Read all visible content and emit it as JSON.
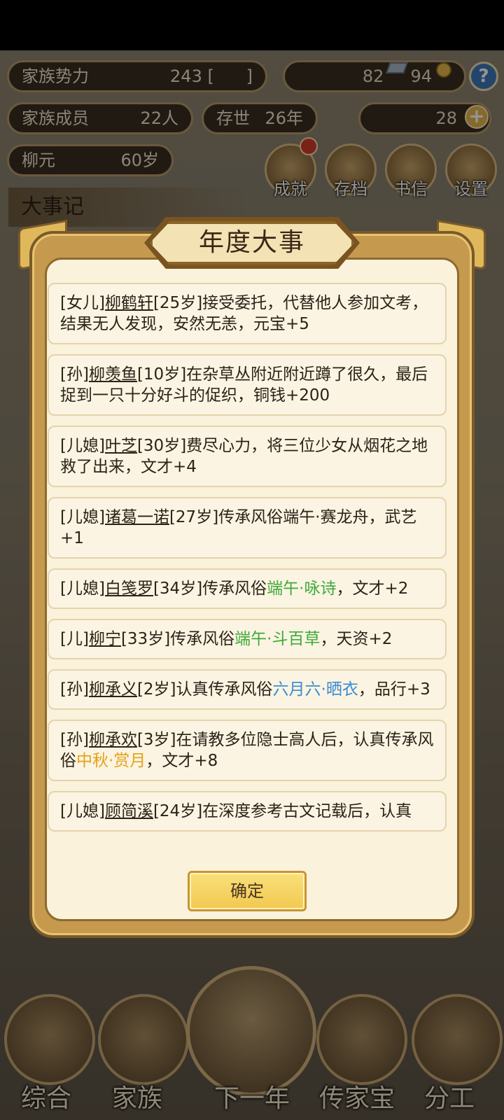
{
  "top_stats": {
    "influence_label": "家族势力",
    "influence_value": "243",
    "members_label": "家族成员",
    "members_value": "22人",
    "alive_label": "存世",
    "alive_value": "26年",
    "head_name": "柳元",
    "head_age": "60岁",
    "silver": "82",
    "coins": "94",
    "gold": "28",
    "help_glyph": "?",
    "plus_glyph": "+"
  },
  "menu": {
    "achievements": "成就",
    "save": "存档",
    "letters": "书信",
    "settings": "设置"
  },
  "events_header": "大事记",
  "bottom_nav": {
    "overview": "综合",
    "family": "家族",
    "next_year": "下一年",
    "heirloom": "传家宝",
    "division": "分工"
  },
  "modal": {
    "title": "年度大事",
    "confirm_label": "确定",
    "events": [
      {
        "relation": "[女儿]",
        "name": "柳鹤轩",
        "age": "[25岁]",
        "pre": "接受委托，代替他人参加文考，结果无人发现，安然无恙，元宝+5",
        "highlight": "",
        "post": ""
      },
      {
        "relation": "[孙]",
        "name": "柳羡鱼",
        "age": "[10岁]",
        "pre": "在杂草丛附近附近蹲了很久，最后捉到一只十分好斗的促织，铜钱+200",
        "highlight": "",
        "post": ""
      },
      {
        "relation": "[儿媳]",
        "name": "叶芝",
        "age": "[30岁]",
        "pre": "费尽心力，将三位少女从烟花之地救了出来，文才+4",
        "highlight": "",
        "post": ""
      },
      {
        "relation": "[儿媳]",
        "name": "诸葛一诺",
        "age": "[27岁]",
        "pre": "传承风俗端午·赛龙舟，武艺+1",
        "highlight": "",
        "post": ""
      },
      {
        "relation": "[儿媳]",
        "name": "白笺罗",
        "age": "[34岁]",
        "pre": "传承风俗",
        "highlight": "端午·咏诗",
        "post": "，文才+2"
      },
      {
        "relation": "[儿]",
        "name": "柳宁",
        "age": "[33岁]",
        "pre": "传承风俗",
        "highlight": "端午·斗百草",
        "post": "，天资+2"
      },
      {
        "relation": "[孙]",
        "name": "柳承义",
        "age": "[2岁]",
        "pre": "认真传承风俗",
        "highlight": "六月六·晒衣",
        "post": "，品行+3"
      },
      {
        "relation": "[孙]",
        "name": "柳承欢",
        "age": "[3岁]",
        "pre": "在请教多位隐士高人后，认真传承风俗",
        "highlight": "中秋·赏月",
        "post": "，文才+8"
      },
      {
        "relation": "[儿媳]",
        "name": "顾简溪",
        "age": "[24岁]",
        "pre": "在深度参考古文记载后，认真",
        "highlight": "",
        "post": ""
      }
    ]
  },
  "colors": {
    "green": "#3eaa3a",
    "blue": "#3a8ad6",
    "orange": "#e3a21a",
    "gold_frame": "#c59a4e"
  }
}
